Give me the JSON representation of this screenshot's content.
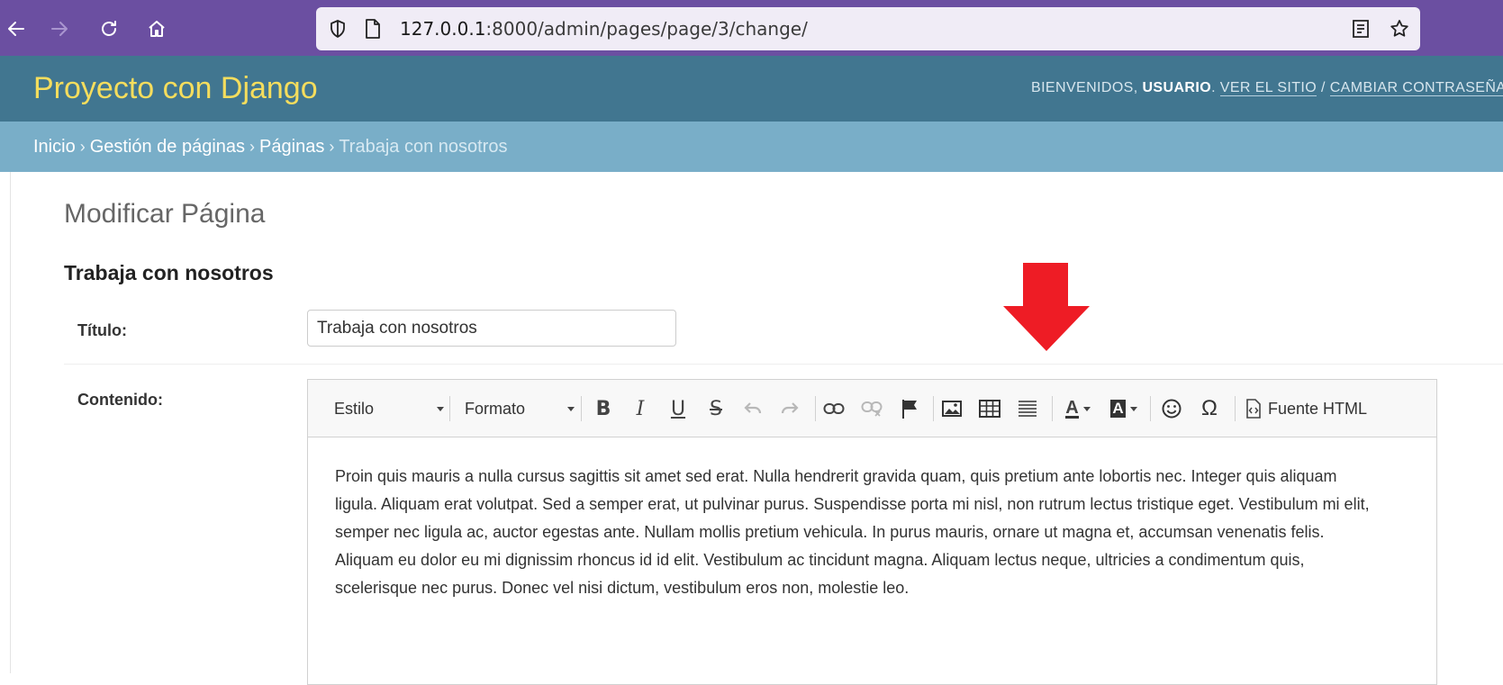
{
  "browser": {
    "url_host": "127.0.0.1",
    "url_path": ":8000/admin/pages/page/3/change/",
    "icons": [
      "back-icon",
      "forward-icon",
      "reload-icon",
      "home-icon",
      "shield-icon",
      "page-icon",
      "reader-mode-icon",
      "bookmark-star-icon"
    ]
  },
  "header": {
    "site_title": "Proyecto con Django",
    "welcome": "BIENVENIDOS,",
    "username": "USUARIO",
    "view_site": "VER EL SITIO",
    "separator": "/",
    "change_password": "CAMBIAR CONTRASEÑA",
    "trailing": "/"
  },
  "breadcrumbs": {
    "items": [
      "Inicio",
      "Gestión de páginas",
      "Páginas"
    ],
    "current": "Trabaja con nosotros",
    "separator": "›"
  },
  "form": {
    "page_heading": "Modificar Página",
    "fieldset_title": "Trabaja con nosotros",
    "title_label": "Título:",
    "title_value": "Trabaja con nosotros",
    "content_label": "Contenido:"
  },
  "editor": {
    "style_label": "Estilo",
    "format_label": "Formato",
    "source_label": "Fuente HTML",
    "buttons": [
      "bold",
      "italic",
      "underline",
      "strikethrough",
      "undo",
      "redo",
      "link",
      "unlink",
      "anchor",
      "image",
      "table",
      "horizontal-rule",
      "text-color",
      "background-color",
      "smiley",
      "special-char",
      "source"
    ],
    "content": "Proin quis mauris a nulla cursus sagittis sit amet sed erat. Nulla hendrerit gravida quam, quis pretium ante lobortis nec. Integer quis aliquam ligula. Aliquam erat volutpat. Sed a semper erat, ut pulvinar purus. Suspendisse porta mi nisl, non rutrum lectus tristique eget. Vestibulum mi elit, semper nec ligula ac, auctor egestas ante. Nullam mollis pretium vehicula. In purus mauris, ornare ut magna et, accumsan venenatis felis. Aliquam eu dolor eu mi dignissim rhoncus id id elit. Vestibulum ac tincidunt magna. Aliquam lectus neque, ultricies a condimentum quis, scelerisque nec purus. Donec vel nisi dictum, vestibulum eros non, molestie leo."
  },
  "colors": {
    "browser_bar": "#6b4fa1",
    "header_bg": "#417690",
    "site_title": "#f5dd5d",
    "breadcrumb_bg": "#79aec8",
    "annotation_arrow": "#ee1c25"
  }
}
